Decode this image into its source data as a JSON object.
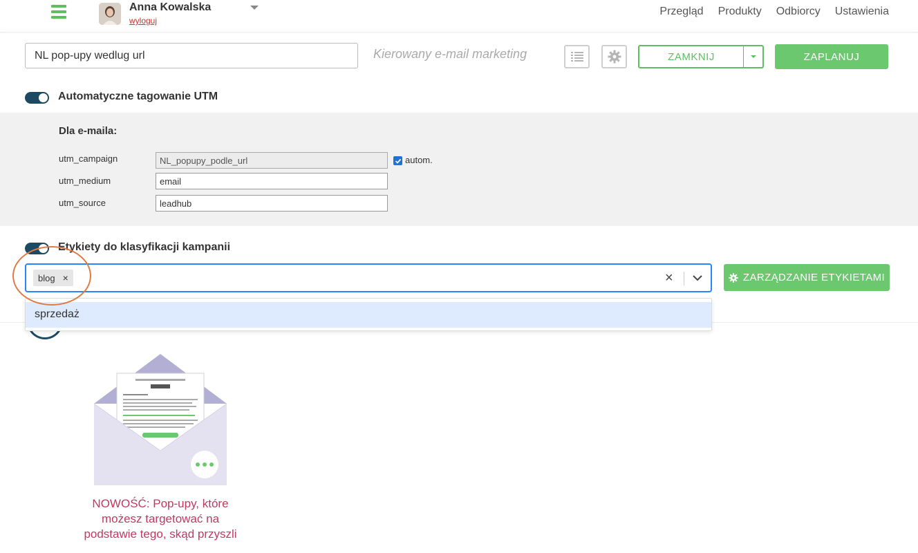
{
  "header": {
    "user_name": "Anna Kowalska",
    "logout_label": "wyloguj",
    "nav": [
      "Przegląd",
      "Produkty",
      "Odbiorcy",
      "Ustawienia"
    ]
  },
  "toolbar": {
    "campaign_name": "NL pop-upy wedlug url",
    "campaign_type": "Kierowany e-mail marketing",
    "close_label": "ZAMKNIJ",
    "schedule_label": "ZAPLANUJ"
  },
  "utm": {
    "title": "Automatyczne tagowanie UTM",
    "enabled": true,
    "heading": "Dla e-maila:",
    "fields": [
      {
        "label": "utm_campaign",
        "value": "NL_popupy_podle_url"
      },
      {
        "label": "utm_medium",
        "value": "email"
      },
      {
        "label": "utm_source",
        "value": "leadhub"
      }
    ],
    "auto_label": "autom.",
    "auto_checked": true
  },
  "tags": {
    "title": "Etykiety do klasyfikacji kampanii",
    "enabled": true,
    "selected": [
      "blog"
    ],
    "options": [
      "sprzedaż"
    ],
    "manage_label": "ZARZĄDZANIE ETYKIETAMI"
  },
  "promo": {
    "text": "NOWOŚĆ: Pop-upy, które możesz targetować na podstawie tego, skąd przyszli"
  },
  "colors": {
    "accent_green": "#6cc86f",
    "toggle_dark": "#1d4a63",
    "focus_blue": "#2684ff",
    "promo_red": "#c0395f"
  }
}
